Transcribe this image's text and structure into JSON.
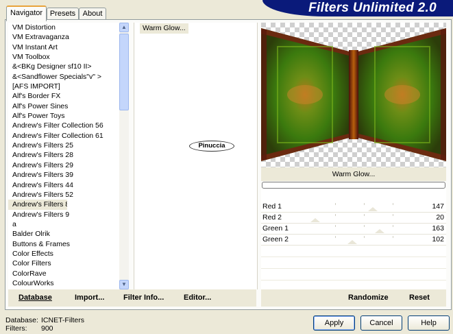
{
  "tabs": [
    {
      "label": "Navigator"
    },
    {
      "label": "Presets"
    },
    {
      "label": "About"
    }
  ],
  "banner": {
    "title": "Filters Unlimited 2.0"
  },
  "filter_list": [
    "VM Distortion",
    "VM Extravaganza",
    "VM Instant Art",
    "VM Toolbox",
    "&<BKg Designer sf10 II>",
    "&<Sandflower Specials\"v\" >",
    "[AFS IMPORT]",
    "Alf's Border FX",
    "Alf's Power Sines",
    "Alf's Power Toys",
    "Andrew's Filter Collection 56",
    "Andrew's Filter Collection 61",
    "Andrew's Filters 25",
    "Andrew's Filters 28",
    "Andrew's Filters 29",
    "Andrew's Filters 39",
    "Andrew's Filters 44",
    "Andrew's Filters 52",
    "Andrew's Filters 8",
    "Andrew's Filters 9",
    "a",
    "Balder Olrik",
    "Buttons & Frames",
    "Color Effects",
    "Color Filters",
    "ColorRave",
    "ColourWorks"
  ],
  "selected_category_index": 18,
  "filter_in_category": "Warm Glow...",
  "logo_text": "Pinuccia",
  "preview": {
    "filter_name": "Warm Glow..."
  },
  "params": [
    {
      "name": "Red 1",
      "value": "147",
      "level": 147
    },
    {
      "name": "Red 2",
      "value": "20",
      "level": 20
    },
    {
      "name": "Green 1",
      "value": "163",
      "level": 163
    },
    {
      "name": "Green 2",
      "value": "102",
      "level": 102
    }
  ],
  "bottom_buttons": {
    "database": "Database",
    "import": "Import...",
    "filter_info": "Filter Info...",
    "editor": "Editor...",
    "randomize": "Randomize",
    "reset": "Reset"
  },
  "footer": {
    "database_label": "Database:",
    "database_value": "ICNET-Filters",
    "filters_label": "Filters:",
    "filters_value": "900"
  },
  "dialog_buttons": {
    "apply": "Apply",
    "cancel": "Cancel",
    "help": "Help"
  },
  "colors": {
    "banner": "#0a1a7a",
    "panel": "#ece9d8",
    "scroll": "#c4d6fb"
  }
}
